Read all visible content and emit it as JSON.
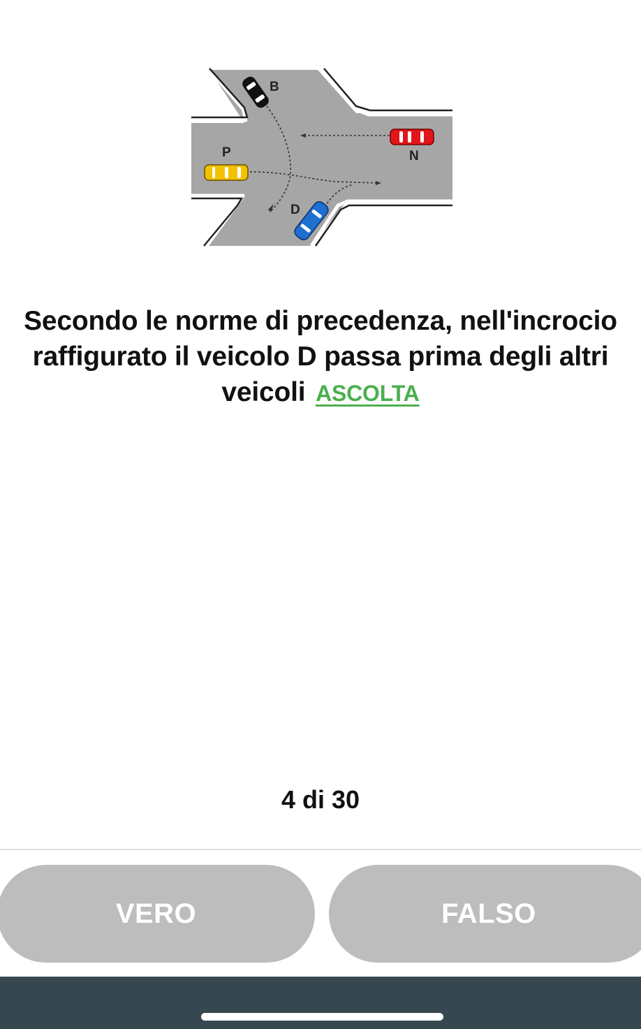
{
  "question": {
    "text": "Secondo le norme di precedenza, nell'incrocio raffigurato il veicolo D passa prima degli altri veicoli",
    "listen_label": "ASCOLTA"
  },
  "diagram": {
    "vehicle_labels": {
      "b": "B",
      "n": "N",
      "p": "P",
      "d": "D"
    },
    "colors": {
      "road": "#a6a6a6",
      "car_b": "#111111",
      "car_n": "#e0161c",
      "car_p": "#f2c200",
      "car_d": "#1e6fd0"
    }
  },
  "progress": {
    "text": "4 di 30"
  },
  "answers": {
    "true_label": "VERO",
    "false_label": "FALSO"
  },
  "colors": {
    "accent_link": "#4caf50",
    "button_bg": "#bdbdbd",
    "bottom_bar": "#37474f"
  }
}
